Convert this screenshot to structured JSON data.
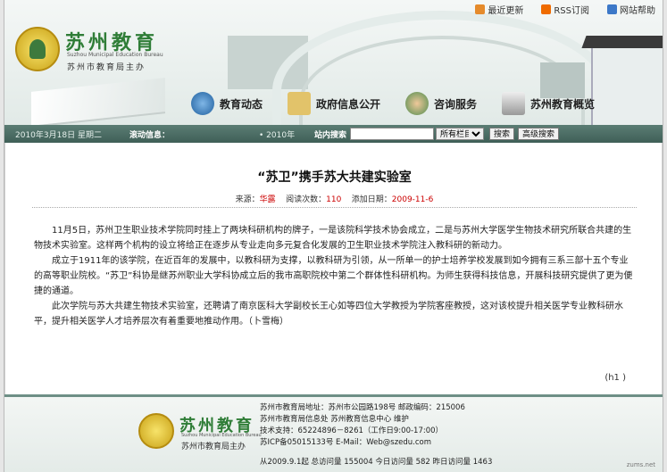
{
  "header": {
    "links": [
      {
        "label": "最近更新",
        "icon": "update-icon"
      },
      {
        "label": "RSS订阅",
        "icon": "rss-icon"
      },
      {
        "label": "网站帮助",
        "icon": "help-icon"
      }
    ],
    "brand_cn": "苏州教育",
    "brand_en": "Suzhou Municipal Education Bureau",
    "brand_sub": "苏州市教育局主办",
    "nav": [
      {
        "label": "教育动态",
        "icon": "globe-icon",
        "color": "#2d6fb0"
      },
      {
        "label": "政府信息公开",
        "icon": "folder-icon",
        "color": "#d9b34a"
      },
      {
        "label": "咨询服务",
        "icon": "people-icon",
        "color": "#4f8d4f"
      },
      {
        "label": "苏州教育概览",
        "icon": "building-icon",
        "color": "#7a7a7a"
      }
    ]
  },
  "bar": {
    "date": "2010年3月18日 星期二",
    "news_label": "滚动信息：",
    "ticker": "• 2010年",
    "search_label": "站内搜索",
    "search_value": "",
    "select_value": "所有栏目",
    "search_button": "搜索",
    "advanced_button": "高级搜索"
  },
  "article": {
    "title": "“苏卫”携手苏大共建实验室",
    "source_label": "来源：",
    "source": "华露",
    "reads_label": "阅读次数：",
    "reads": "110",
    "date_label": "添加日期：",
    "date": "2009-11-6",
    "paragraphs": [
      "11月5日，苏州卫生职业技术学院同时挂上了两块科研机构的牌子，一是该院科学技术协会成立，二是与苏州大学医学生物技术研究所联合共建的生物技术实验室。这样两个机构的设立将给正在逐步从专业走向多元复合化发展的卫生职业技术学院注入教科研的新动力。",
      "成立于1911年的该学院，在近百年的发展中，以教科研为支撑，以教科研为引领，从一所单一的护士培养学校发展到如今拥有三系三部十五个专业的高等职业院校。“苏卫”科协是继苏州职业大学科协成立后的我市高职院校中第二个群体性科研机构。为师生获得科技信息，开展科技研究提供了更为便捷的通道。",
      "此次学院与苏大共建生物技术实验室，还聘请了南京医科大学副校长王心如等四位大学教授为学院客座教授，这对该校提升相关医学专业教科研水平，提升相关医学人才培养层次有着重要地推动作用。（卜雪梅）"
    ],
    "footer_mark": "(h1 )"
  },
  "footer": {
    "brand_cn": "苏州教育",
    "brand_en": "Suzhou Municipal Education Bureau",
    "brand_sub": "苏州市教育局主办",
    "info": [
      "苏州市教育局地址：苏州市公园路198号 邮政编码：215006",
      "苏州市教育局信息处 苏州教育信息中心 维护",
      "技术支持：65224896－8261（工作日9:00-17:00）",
      "苏ICP备05015133号 E-Mail：Web@szedu.com"
    ],
    "stats": "从2009.9.1起 总访问量 155004 今日访问量 582 昨日访问量 1463",
    "watermark": "zums.net"
  }
}
